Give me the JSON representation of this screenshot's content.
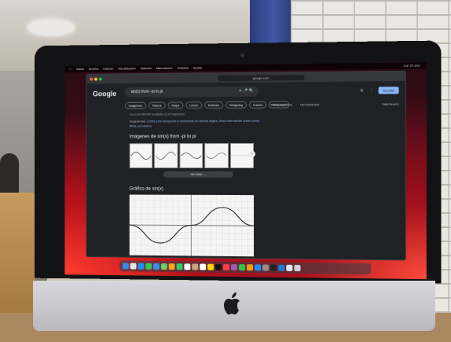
{
  "menubar": {
    "items": [
      "Safari",
      "Archivo",
      "Edición",
      "Visualización",
      "Historial",
      "Marcadores",
      "Ventana",
      "Ayuda"
    ],
    "status": "Lun 21 ene"
  },
  "browser": {
    "url": "google.com",
    "logo": "Google",
    "query": "sin(x) from -pi to pi",
    "signin_label": "Acceder",
    "tabs": [
      "Imágenes",
      "Videos",
      "Mapa",
      "Libros",
      "Noticias",
      "Shopping",
      "Vuelos",
      "Finanzas"
    ],
    "tools_label": "Todos los filtros",
    "herramientas_label": "Herramientas",
    "safesearch_label": "SafeSearch",
    "result_stats": "Cerca de 944.000 resultados (0,42 segundos)",
    "suggestion_prefix": "Sugerencia:",
    "suggestion_link": "Limita esta búsqueda a resultados en idioma Inglés.",
    "suggestion_more": "Más información sobre cómo filtrar por idioma",
    "images_title": "Imágenes de sin(x) from -pi to pi",
    "view_all_label": "Ver todo",
    "graph_title": "Gráfico de sin(x)"
  },
  "dock": {
    "icons": [
      {
        "name": "finder-icon",
        "color": "#2f8cf0"
      },
      {
        "name": "launchpad-icon",
        "color": "#e6e6e6"
      },
      {
        "name": "safari-icon",
        "color": "#1e90ff"
      },
      {
        "name": "messages-icon",
        "color": "#34c759"
      },
      {
        "name": "mail-icon",
        "color": "#3a8ef0"
      },
      {
        "name": "maps-icon",
        "color": "#6bd26b"
      },
      {
        "name": "photos-icon",
        "color": "#f5a623"
      },
      {
        "name": "facetime-icon",
        "color": "#2ecc71"
      },
      {
        "name": "calendar-icon",
        "color": "#ffffff"
      },
      {
        "name": "contacts-icon",
        "color": "#c8a97a"
      },
      {
        "name": "reminders-icon",
        "color": "#ffffff"
      },
      {
        "name": "notes-icon",
        "color": "#ffd60a"
      },
      {
        "name": "tv-icon",
        "color": "#111111"
      },
      {
        "name": "music-icon",
        "color": "#fc3c44"
      },
      {
        "name": "podcasts-icon",
        "color": "#9b59b6"
      },
      {
        "name": "numbers-icon",
        "color": "#30c247"
      },
      {
        "name": "pages-icon",
        "color": "#f39c12"
      },
      {
        "name": "app-store-icon",
        "color": "#1c8cf0"
      },
      {
        "name": "settings-icon",
        "color": "#8e8e93"
      },
      {
        "name": "terminal-icon",
        "color": "#222222"
      },
      {
        "name": "vscode-icon",
        "color": "#1f7ad3"
      },
      {
        "name": "preview-icon",
        "color": "#dfe6ef"
      },
      {
        "name": "trash-icon",
        "color": "#cfd3d8"
      }
    ]
  }
}
